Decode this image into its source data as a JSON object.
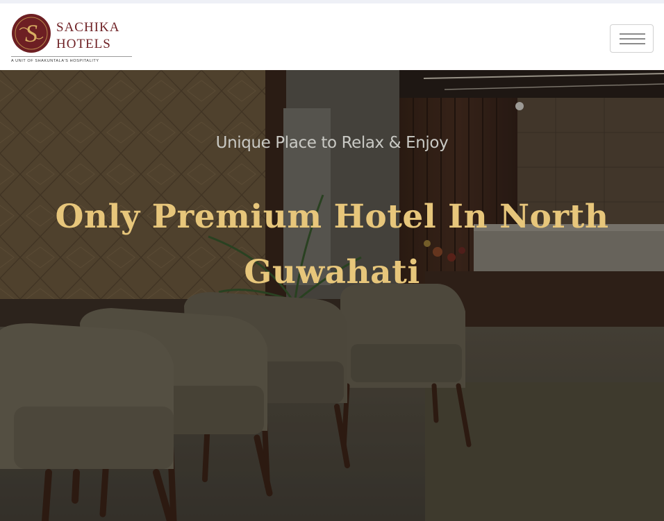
{
  "brand": {
    "name_line_1": "SACHIKA",
    "name_line_2": "HOTELS",
    "tagline": "A UNIT OF SHAKUNTALA'S HOSPITALITY",
    "emblem_letter": "S",
    "color": "#6d1f23"
  },
  "nav": {
    "toggle_icon": "hamburger-menu-icon"
  },
  "hero": {
    "eyebrow": "Unique Place to Relax & Enjoy",
    "title": "Only Premium Hotel In North Guwahati",
    "title_color": "#e7c67b"
  }
}
